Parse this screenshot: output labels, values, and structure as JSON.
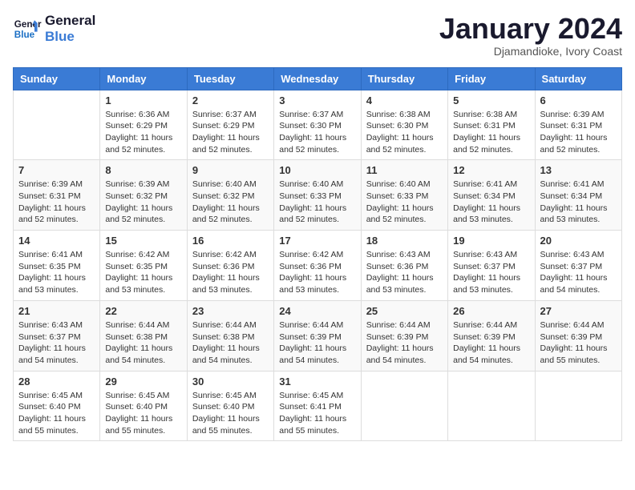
{
  "logo": {
    "line1": "General",
    "line2": "Blue"
  },
  "title": "January 2024",
  "subtitle": "Djamandioke, Ivory Coast",
  "days_of_week": [
    "Sunday",
    "Monday",
    "Tuesday",
    "Wednesday",
    "Thursday",
    "Friday",
    "Saturday"
  ],
  "weeks": [
    [
      {
        "day": "",
        "sunrise": "",
        "sunset": "",
        "daylight": ""
      },
      {
        "day": "1",
        "sunrise": "Sunrise: 6:36 AM",
        "sunset": "Sunset: 6:29 PM",
        "daylight": "Daylight: 11 hours and 52 minutes."
      },
      {
        "day": "2",
        "sunrise": "Sunrise: 6:37 AM",
        "sunset": "Sunset: 6:29 PM",
        "daylight": "Daylight: 11 hours and 52 minutes."
      },
      {
        "day": "3",
        "sunrise": "Sunrise: 6:37 AM",
        "sunset": "Sunset: 6:30 PM",
        "daylight": "Daylight: 11 hours and 52 minutes."
      },
      {
        "day": "4",
        "sunrise": "Sunrise: 6:38 AM",
        "sunset": "Sunset: 6:30 PM",
        "daylight": "Daylight: 11 hours and 52 minutes."
      },
      {
        "day": "5",
        "sunrise": "Sunrise: 6:38 AM",
        "sunset": "Sunset: 6:31 PM",
        "daylight": "Daylight: 11 hours and 52 minutes."
      },
      {
        "day": "6",
        "sunrise": "Sunrise: 6:39 AM",
        "sunset": "Sunset: 6:31 PM",
        "daylight": "Daylight: 11 hours and 52 minutes."
      }
    ],
    [
      {
        "day": "7",
        "sunrise": "Sunrise: 6:39 AM",
        "sunset": "Sunset: 6:31 PM",
        "daylight": "Daylight: 11 hours and 52 minutes."
      },
      {
        "day": "8",
        "sunrise": "Sunrise: 6:39 AM",
        "sunset": "Sunset: 6:32 PM",
        "daylight": "Daylight: 11 hours and 52 minutes."
      },
      {
        "day": "9",
        "sunrise": "Sunrise: 6:40 AM",
        "sunset": "Sunset: 6:32 PM",
        "daylight": "Daylight: 11 hours and 52 minutes."
      },
      {
        "day": "10",
        "sunrise": "Sunrise: 6:40 AM",
        "sunset": "Sunset: 6:33 PM",
        "daylight": "Daylight: 11 hours and 52 minutes."
      },
      {
        "day": "11",
        "sunrise": "Sunrise: 6:40 AM",
        "sunset": "Sunset: 6:33 PM",
        "daylight": "Daylight: 11 hours and 52 minutes."
      },
      {
        "day": "12",
        "sunrise": "Sunrise: 6:41 AM",
        "sunset": "Sunset: 6:34 PM",
        "daylight": "Daylight: 11 hours and 53 minutes."
      },
      {
        "day": "13",
        "sunrise": "Sunrise: 6:41 AM",
        "sunset": "Sunset: 6:34 PM",
        "daylight": "Daylight: 11 hours and 53 minutes."
      }
    ],
    [
      {
        "day": "14",
        "sunrise": "Sunrise: 6:41 AM",
        "sunset": "Sunset: 6:35 PM",
        "daylight": "Daylight: 11 hours and 53 minutes."
      },
      {
        "day": "15",
        "sunrise": "Sunrise: 6:42 AM",
        "sunset": "Sunset: 6:35 PM",
        "daylight": "Daylight: 11 hours and 53 minutes."
      },
      {
        "day": "16",
        "sunrise": "Sunrise: 6:42 AM",
        "sunset": "Sunset: 6:36 PM",
        "daylight": "Daylight: 11 hours and 53 minutes."
      },
      {
        "day": "17",
        "sunrise": "Sunrise: 6:42 AM",
        "sunset": "Sunset: 6:36 PM",
        "daylight": "Daylight: 11 hours and 53 minutes."
      },
      {
        "day": "18",
        "sunrise": "Sunrise: 6:43 AM",
        "sunset": "Sunset: 6:36 PM",
        "daylight": "Daylight: 11 hours and 53 minutes."
      },
      {
        "day": "19",
        "sunrise": "Sunrise: 6:43 AM",
        "sunset": "Sunset: 6:37 PM",
        "daylight": "Daylight: 11 hours and 53 minutes."
      },
      {
        "day": "20",
        "sunrise": "Sunrise: 6:43 AM",
        "sunset": "Sunset: 6:37 PM",
        "daylight": "Daylight: 11 hours and 54 minutes."
      }
    ],
    [
      {
        "day": "21",
        "sunrise": "Sunrise: 6:43 AM",
        "sunset": "Sunset: 6:37 PM",
        "daylight": "Daylight: 11 hours and 54 minutes."
      },
      {
        "day": "22",
        "sunrise": "Sunrise: 6:44 AM",
        "sunset": "Sunset: 6:38 PM",
        "daylight": "Daylight: 11 hours and 54 minutes."
      },
      {
        "day": "23",
        "sunrise": "Sunrise: 6:44 AM",
        "sunset": "Sunset: 6:38 PM",
        "daylight": "Daylight: 11 hours and 54 minutes."
      },
      {
        "day": "24",
        "sunrise": "Sunrise: 6:44 AM",
        "sunset": "Sunset: 6:39 PM",
        "daylight": "Daylight: 11 hours and 54 minutes."
      },
      {
        "day": "25",
        "sunrise": "Sunrise: 6:44 AM",
        "sunset": "Sunset: 6:39 PM",
        "daylight": "Daylight: 11 hours and 54 minutes."
      },
      {
        "day": "26",
        "sunrise": "Sunrise: 6:44 AM",
        "sunset": "Sunset: 6:39 PM",
        "daylight": "Daylight: 11 hours and 54 minutes."
      },
      {
        "day": "27",
        "sunrise": "Sunrise: 6:44 AM",
        "sunset": "Sunset: 6:39 PM",
        "daylight": "Daylight: 11 hours and 55 minutes."
      }
    ],
    [
      {
        "day": "28",
        "sunrise": "Sunrise: 6:45 AM",
        "sunset": "Sunset: 6:40 PM",
        "daylight": "Daylight: 11 hours and 55 minutes."
      },
      {
        "day": "29",
        "sunrise": "Sunrise: 6:45 AM",
        "sunset": "Sunset: 6:40 PM",
        "daylight": "Daylight: 11 hours and 55 minutes."
      },
      {
        "day": "30",
        "sunrise": "Sunrise: 6:45 AM",
        "sunset": "Sunset: 6:40 PM",
        "daylight": "Daylight: 11 hours and 55 minutes."
      },
      {
        "day": "31",
        "sunrise": "Sunrise: 6:45 AM",
        "sunset": "Sunset: 6:41 PM",
        "daylight": "Daylight: 11 hours and 55 minutes."
      },
      {
        "day": "",
        "sunrise": "",
        "sunset": "",
        "daylight": ""
      },
      {
        "day": "",
        "sunrise": "",
        "sunset": "",
        "daylight": ""
      },
      {
        "day": "",
        "sunrise": "",
        "sunset": "",
        "daylight": ""
      }
    ]
  ]
}
